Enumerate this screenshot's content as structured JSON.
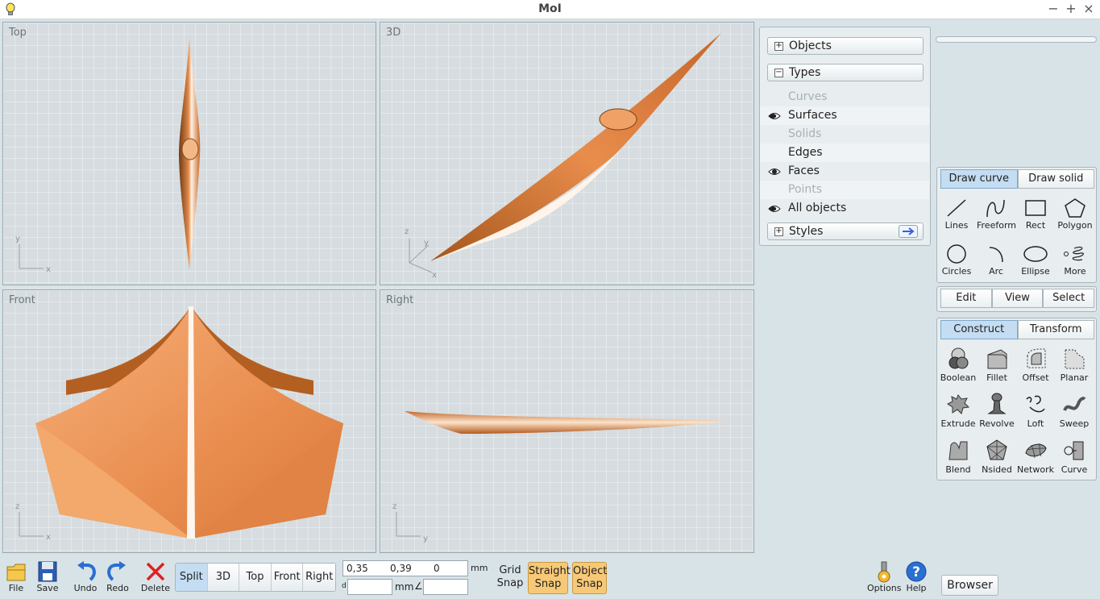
{
  "window": {
    "title": "MoI",
    "minimize": "−",
    "maximize": "+",
    "close": "×"
  },
  "viewports": {
    "top": {
      "label": "Top",
      "axis_v": "y",
      "axis_h": "x"
    },
    "three_d": {
      "label": "3D",
      "axis_z": "z",
      "axis_y": "y",
      "axis_x": "x"
    },
    "front": {
      "label": "Front",
      "axis_v": "z",
      "axis_h": "x"
    },
    "right": {
      "label": "Right",
      "axis_v": "z",
      "axis_h": "y"
    }
  },
  "scene_panel": {
    "objects_label": "Objects",
    "types_label": "Types",
    "styles_label": "Styles",
    "types": [
      {
        "label": "Curves",
        "visible": false
      },
      {
        "label": "Surfaces",
        "visible": true
      },
      {
        "label": "Solids",
        "visible": false
      },
      {
        "label": "Edges",
        "visible": false
      },
      {
        "label": "Faces",
        "visible": true
      },
      {
        "label": "Points",
        "visible": false
      },
      {
        "label": "All objects",
        "visible": true
      }
    ]
  },
  "draw_palette": {
    "tabs": [
      "Draw curve",
      "Draw solid"
    ],
    "tools": [
      "Lines",
      "Freeform",
      "Rect",
      "Polygon",
      "Circles",
      "Arc",
      "Ellipse",
      "More"
    ]
  },
  "edit_bar": {
    "tabs": [
      "Edit",
      "View",
      "Select"
    ]
  },
  "construct_palette": {
    "tabs": [
      "Construct",
      "Transform"
    ],
    "tools": [
      "Boolean",
      "Fillet",
      "Offset",
      "Planar",
      "Extrude",
      "Revolve",
      "Loft",
      "Sweep",
      "Blend",
      "Nsided",
      "Network",
      "Curve"
    ]
  },
  "bottom_bar": {
    "file": "File",
    "save": "Save",
    "undo": "Undo",
    "redo": "Redo",
    "delete": "Delete",
    "view_modes": [
      "Split",
      "3D",
      "Top",
      "Front",
      "Right"
    ],
    "coords": {
      "x": "0,35",
      "y": "0,39",
      "z": "0",
      "unit": "mm",
      "d_label": "d",
      "d_unit": "mm",
      "angle_symbol": "∠"
    },
    "grid_snap": [
      "Grid",
      "Snap"
    ],
    "straight_snap": [
      "Straight",
      "Snap"
    ],
    "object_snap": [
      "Object",
      "Snap"
    ],
    "options": "Options",
    "help": "Help",
    "browser": "Browser"
  },
  "colors": {
    "accent": "#c4ddf2",
    "snap": "#f7c977",
    "model": "#e8955a"
  }
}
